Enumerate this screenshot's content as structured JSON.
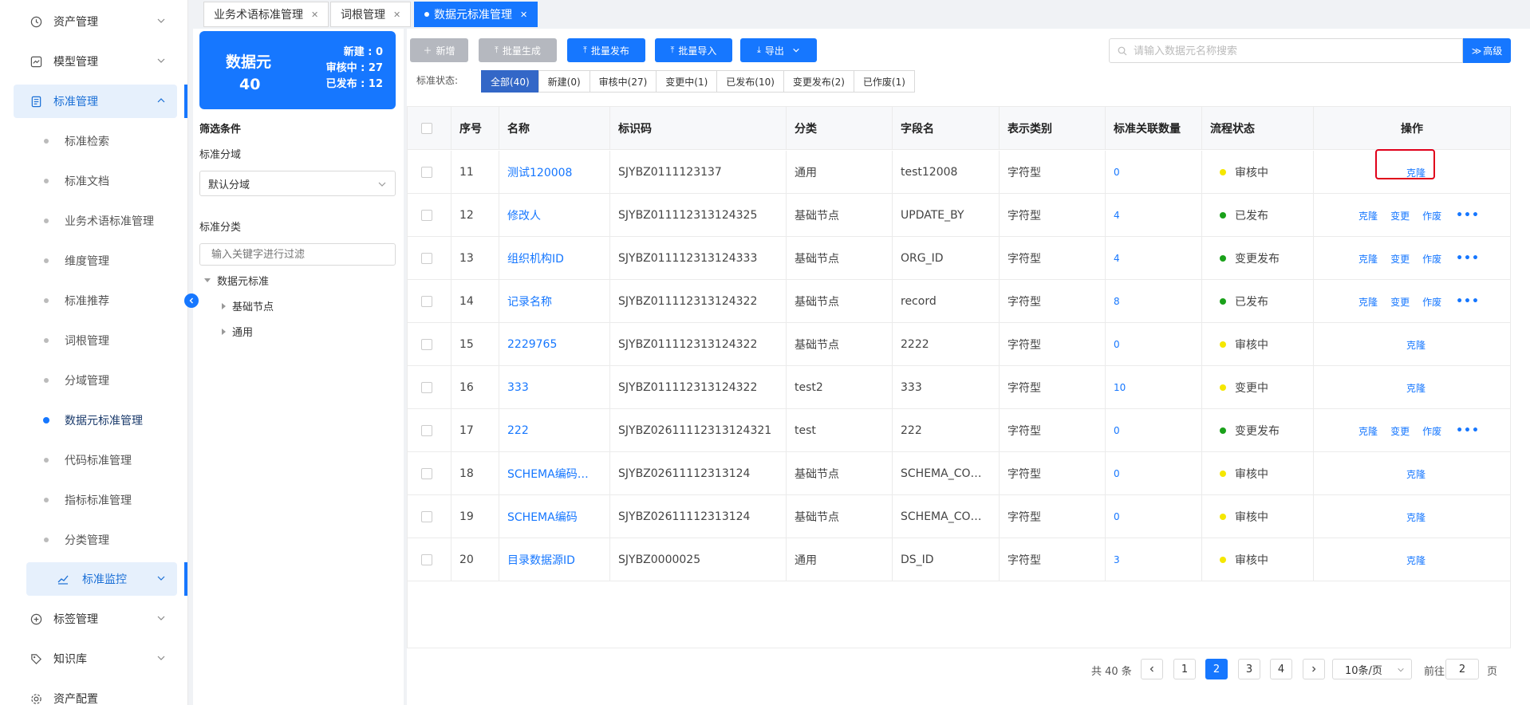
{
  "sidebar": {
    "items": [
      {
        "label": "资产管理",
        "icon": "clock-icon"
      },
      {
        "label": "模型管理",
        "icon": "chart-icon"
      },
      {
        "label": "标准管理",
        "icon": "document-icon"
      }
    ],
    "sub_items": [
      "标准检索",
      "标准文档",
      "业务术语标准管理",
      "维度管理",
      "标准推荐",
      "词根管理",
      "分域管理",
      "数据元标准管理",
      "代码标准管理",
      "指标标准管理",
      "分类管理"
    ],
    "group_item": "标准监控",
    "bottom_items": [
      {
        "label": "标签管理",
        "icon": "plus-circle-icon"
      },
      {
        "label": "知识库",
        "icon": "tag-icon"
      },
      {
        "label": "资产配置",
        "icon": "gear-icon"
      }
    ]
  },
  "tabs": [
    {
      "label": "业务术语标准管理"
    },
    {
      "label": "词根管理"
    },
    {
      "label": "数据元标准管理"
    }
  ],
  "summary": {
    "title": "数据元",
    "count": "40",
    "new": "新建 : 0",
    "reviewing": "审核中 : 27",
    "published": "已发布 : 12"
  },
  "filter": {
    "heading": "筛选条件",
    "domain_label": "标准分域",
    "domain_value": "默认分域",
    "category_label": "标准分类",
    "search_placeholder": "输入关键字进行过滤",
    "tree_root": "数据元标准",
    "tree_children": [
      "基础节点",
      "通用"
    ]
  },
  "toolbar": {
    "new": "新增",
    "batch_generate": "批量生成",
    "batch_publish": "批量发布",
    "batch_import": "批量导入",
    "export": "导出",
    "search_placeholder": "请输入数据元名称搜索",
    "advanced": "高级"
  },
  "status_filter": {
    "label": "标准状态:",
    "options": [
      "全部(40)",
      "新建(0)",
      "审核中(27)",
      "变更中(1)",
      "已发布(10)",
      "变更发布(2)",
      "已作废(1)"
    ]
  },
  "table": {
    "columns": [
      "序号",
      "名称",
      "标识码",
      "分类",
      "字段名",
      "表示类别",
      "标准关联数量",
      "流程状态",
      "操作"
    ],
    "rows": [
      {
        "no": "11",
        "name": "测试120008",
        "code": "SJYBZ0111123137",
        "category": "通用",
        "field": "test12008",
        "type": "字符型",
        "count": "0",
        "status": "审核中",
        "status_color": "#f5e700",
        "actions": [
          "克隆"
        ],
        "more": false
      },
      {
        "no": "12",
        "name": "修改人",
        "code": "SJYBZ011112313124325",
        "category": "基础节点",
        "field": "UPDATE_BY",
        "type": "字符型",
        "count": "4",
        "status": "已发布",
        "status_color": "#1aa11a",
        "actions": [
          "克隆",
          "变更",
          "作废"
        ],
        "more": true
      },
      {
        "no": "13",
        "name": "组织机构ID",
        "code": "SJYBZ011112313124333",
        "category": "基础节点",
        "field": "ORG_ID",
        "type": "字符型",
        "count": "4",
        "status": "变更发布",
        "status_color": "#1aa11a",
        "actions": [
          "克隆",
          "变更",
          "作废"
        ],
        "more": true
      },
      {
        "no": "14",
        "name": "记录名称",
        "code": "SJYBZ011112313124322",
        "category": "基础节点",
        "field": "record",
        "type": "字符型",
        "count": "8",
        "status": "已发布",
        "status_color": "#1aa11a",
        "actions": [
          "克隆",
          "变更",
          "作废"
        ],
        "more": true
      },
      {
        "no": "15",
        "name": "2229765",
        "code": "SJYBZ011112313124322",
        "category": "基础节点",
        "field": "2222",
        "type": "字符型",
        "count": "0",
        "status": "审核中",
        "status_color": "#f5e700",
        "actions": [
          "克隆"
        ],
        "more": false
      },
      {
        "no": "16",
        "name": "333",
        "code": "SJYBZ011112313124322",
        "category": "test2",
        "field": "333",
        "type": "字符型",
        "count": "10",
        "status": "变更中",
        "status_color": "#f5e700",
        "actions": [
          "克隆"
        ],
        "more": false
      },
      {
        "no": "17",
        "name": "222",
        "code": "SJYBZ02611112313124321",
        "category": "test",
        "field": "222",
        "type": "字符型",
        "count": "0",
        "status": "变更发布",
        "status_color": "#1aa11a",
        "actions": [
          "克隆",
          "变更",
          "作废"
        ],
        "more": true
      },
      {
        "no": "18",
        "name": "SCHEMA编码…",
        "code": "SJYBZ02611112313124",
        "category": "基础节点",
        "field": "SCHEMA_CO…",
        "type": "字符型",
        "count": "0",
        "status": "审核中",
        "status_color": "#f5e700",
        "actions": [
          "克隆"
        ],
        "more": false
      },
      {
        "no": "19",
        "name": "SCHEMA编码",
        "code": "SJYBZ02611112313124",
        "category": "基础节点",
        "field": "SCHEMA_CO…",
        "type": "字符型",
        "count": "0",
        "status": "审核中",
        "status_color": "#f5e700",
        "actions": [
          "克隆"
        ],
        "more": false
      },
      {
        "no": "20",
        "name": "目录数据源ID",
        "code": "SJYBZ0000025",
        "category": "通用",
        "field": "DS_ID",
        "type": "字符型",
        "count": "3",
        "status": "审核中",
        "status_color": "#f5e700",
        "actions": [
          "克隆"
        ],
        "more": false
      }
    ]
  },
  "pagination": {
    "total": "共 40 条",
    "pages": [
      "1",
      "2",
      "3",
      "4"
    ],
    "current": "2",
    "page_size": "10条/页",
    "goto_label": "前往",
    "goto_value": "2",
    "page_unit": "页"
  },
  "colors": {
    "primary": "#1677ff",
    "status_active": "#3367c7",
    "highlight": "#e0001a"
  }
}
